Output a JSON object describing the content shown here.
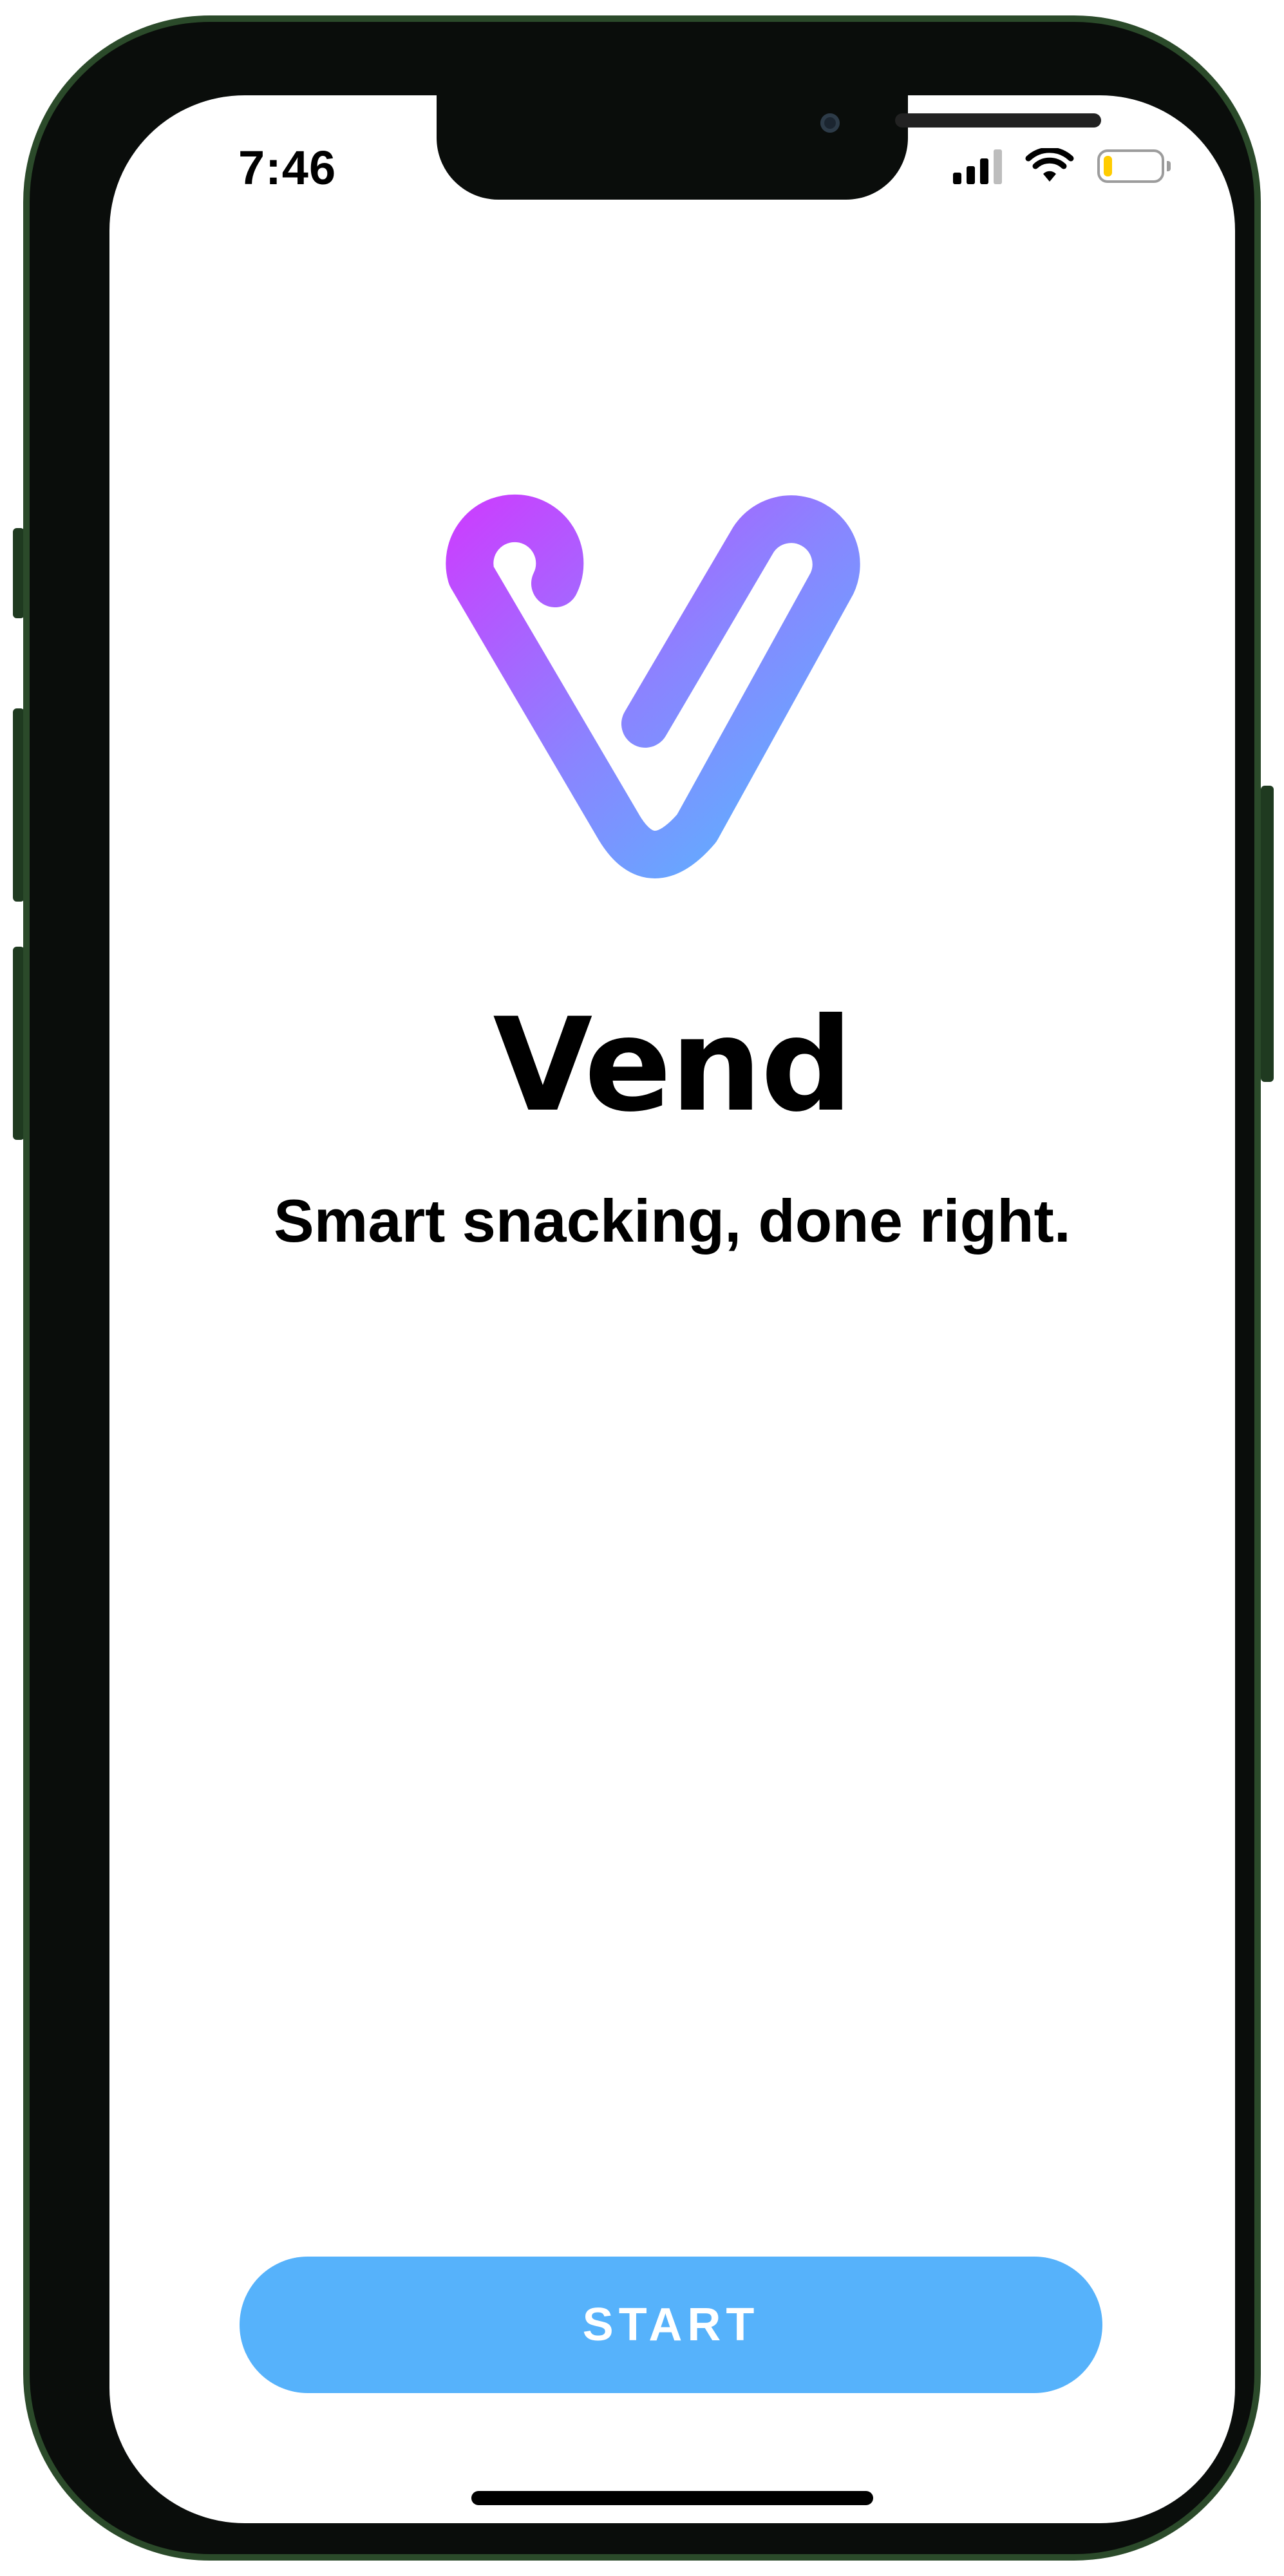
{
  "status_bar": {
    "time": "7:46",
    "icons": [
      "signal-icon",
      "wifi-icon",
      "battery-icon"
    ],
    "battery_level": 0.15
  },
  "app": {
    "name": "Vend",
    "tagline": "Smart snacking, done right.",
    "start_label": "START",
    "logo": "vend-v-logo"
  },
  "colors": {
    "accent": "#56b2fb",
    "logo_gradient_start": "#c742ff",
    "logo_gradient_end": "#56b8ff",
    "battery_fill": "#ffcc00",
    "frame": "#2b4a2a"
  }
}
